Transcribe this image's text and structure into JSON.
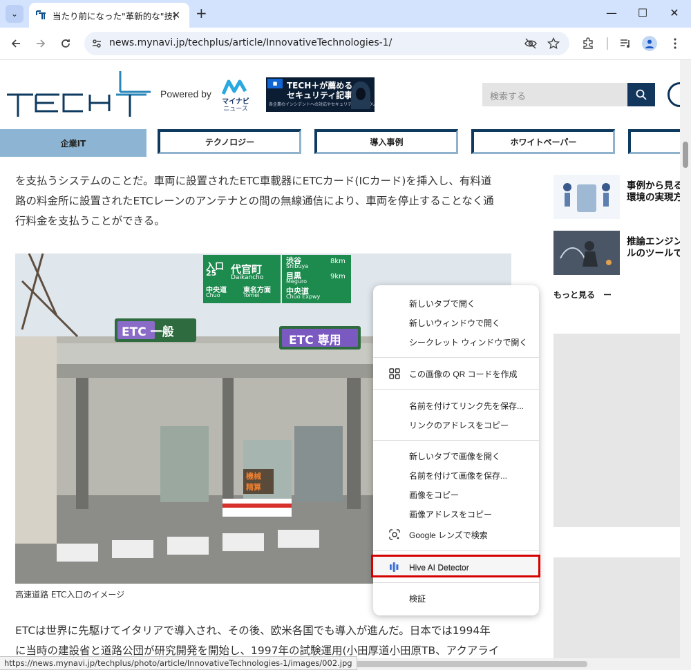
{
  "browser": {
    "tab_title": "当たり前になった\"革新的な\"技術た",
    "url": "news.mynavi.jp/techplus/article/InnovativeTechnologies-1/",
    "status_url": "https://news.mynavi.jp/techplus/photo/article/InnovativeTechnologies-1/images/002.jpg",
    "window_controls": {
      "minimize": "—",
      "maximize": "☐",
      "close": "✕"
    }
  },
  "header": {
    "powered_by": "Powered by",
    "mynavi_label": "マイナビ",
    "mynavi_sub": "ニュース",
    "banner_line1": "TECH＋が薦める",
    "banner_line2": "セキュリティ記事",
    "banner_line3": "各企業のインシデントへの対応やセキュリティ対策について",
    "search_placeholder": "検索する"
  },
  "nav": {
    "tabs": [
      {
        "label": "企業IT"
      },
      {
        "label": "テクノロジー"
      },
      {
        "label": "導入事例"
      },
      {
        "label": "ホワイトペーパー"
      }
    ]
  },
  "article": {
    "para1_line1": "を支払うシステムのことだ。車両に設置されたETC車載器にETCカード(ICカード)を挿入し、有料道",
    "para1_line2": "路の料金所に設置されたETCレーンのアンテナとの間の無線通信により、車両を停止することなく通",
    "para1_line3": "行料金を支払うことができる。",
    "photo_caption": "高速道路 ETC入口のイメージ",
    "para2_line1": "ETCは世界に先駆けてイタリアで導入され、その後、欧米各国でも導入が進んだ。日本では1994年",
    "para2_line2": "に当時の建設省と道路公団が研究開発を開始し、1997年の試験運用(小田厚道小田原TB、アクアライ"
  },
  "photo_signs": {
    "etc_general": "ETC 一般",
    "etc_only": "ETC 専用",
    "daikancho": "代官町",
    "daikancho_en": "Daikancho",
    "shibuya": "渋谷",
    "shibuya_en": "Shibuya",
    "shibuya_km": "8km",
    "meguro": "目黒",
    "meguro_en": "Meguro",
    "meguro_km": "9km",
    "chuo": "中央道",
    "chuo_en": "Chuo",
    "tomei": "東名方面",
    "tomei_en": "Tomei",
    "chuo_expwy": "中央道",
    "chuo_expwy_en": "Chuo Expwy",
    "iriguchi": "入口",
    "number": "25",
    "machine": "機械",
    "seisan": "精算"
  },
  "sidebar": {
    "items": [
      {
        "title_line1": "事例から見る",
        "title_line2": "環境の実現方"
      },
      {
        "title_line1": "推論エンジン",
        "title_line2": "ルのツールで"
      }
    ],
    "more": "もっと見る　ー"
  },
  "context_menu": {
    "items": [
      {
        "label": "新しいタブで開く"
      },
      {
        "label": "新しいウィンドウで開く"
      },
      {
        "label": "シークレット ウィンドウで開く"
      },
      {
        "label": "この画像の QR コードを作成"
      },
      {
        "label": "名前を付けてリンク先を保存..."
      },
      {
        "label": "リンクのアドレスをコピー"
      },
      {
        "label": "新しいタブで画像を開く"
      },
      {
        "label": "名前を付けて画像を保存..."
      },
      {
        "label": "画像をコピー"
      },
      {
        "label": "画像アドレスをコピー"
      },
      {
        "label": "Google レンズで検索"
      },
      {
        "label": "Hive AI Detector"
      },
      {
        "label": "検証"
      }
    ]
  },
  "colors": {
    "highlight": "#d50000",
    "nav_active": "#8db5d3",
    "brand_navy": "#12365c"
  }
}
